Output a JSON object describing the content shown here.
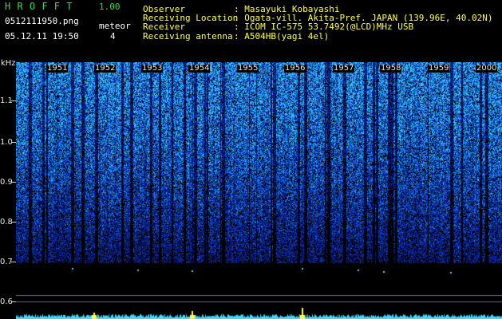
{
  "app": {
    "name": "H R O F F T",
    "version": "1.00",
    "filename": "0512111950.png",
    "datetime": "05.12.11 19:50",
    "meteor_label": "meteor",
    "meteor_count": "4"
  },
  "info": {
    "labels": [
      "Observer",
      "Receiving Location",
      "Receiver",
      "Receiving antenna"
    ],
    "values": [
      ": Masayuki Kobayashi",
      ": Ogata-vill. Akita-Pref. JAPAN (139.96E, 40.02N)",
      ": ICOM IC-575 53.7492(@LCD)MHz USB",
      ": A504HB(yagi 4el)"
    ]
  },
  "chart_data": {
    "type": "heatmap",
    "ylabel": "kHz",
    "y_ticks": [
      "1.1",
      "1.0",
      "0.9",
      "0.8",
      "0.7",
      "0.6"
    ],
    "x_ticks": [
      "1951",
      "1952",
      "1953",
      "1954",
      "1955",
      "1956",
      "1957",
      "1958",
      "1959",
      "2000"
    ],
    "colors": {
      "background": "#000000",
      "noise_low": "#0a1f9e",
      "noise_high": "#3fd9ff",
      "peak": "#ffff40",
      "text_green": "#3fd94a"
    }
  }
}
